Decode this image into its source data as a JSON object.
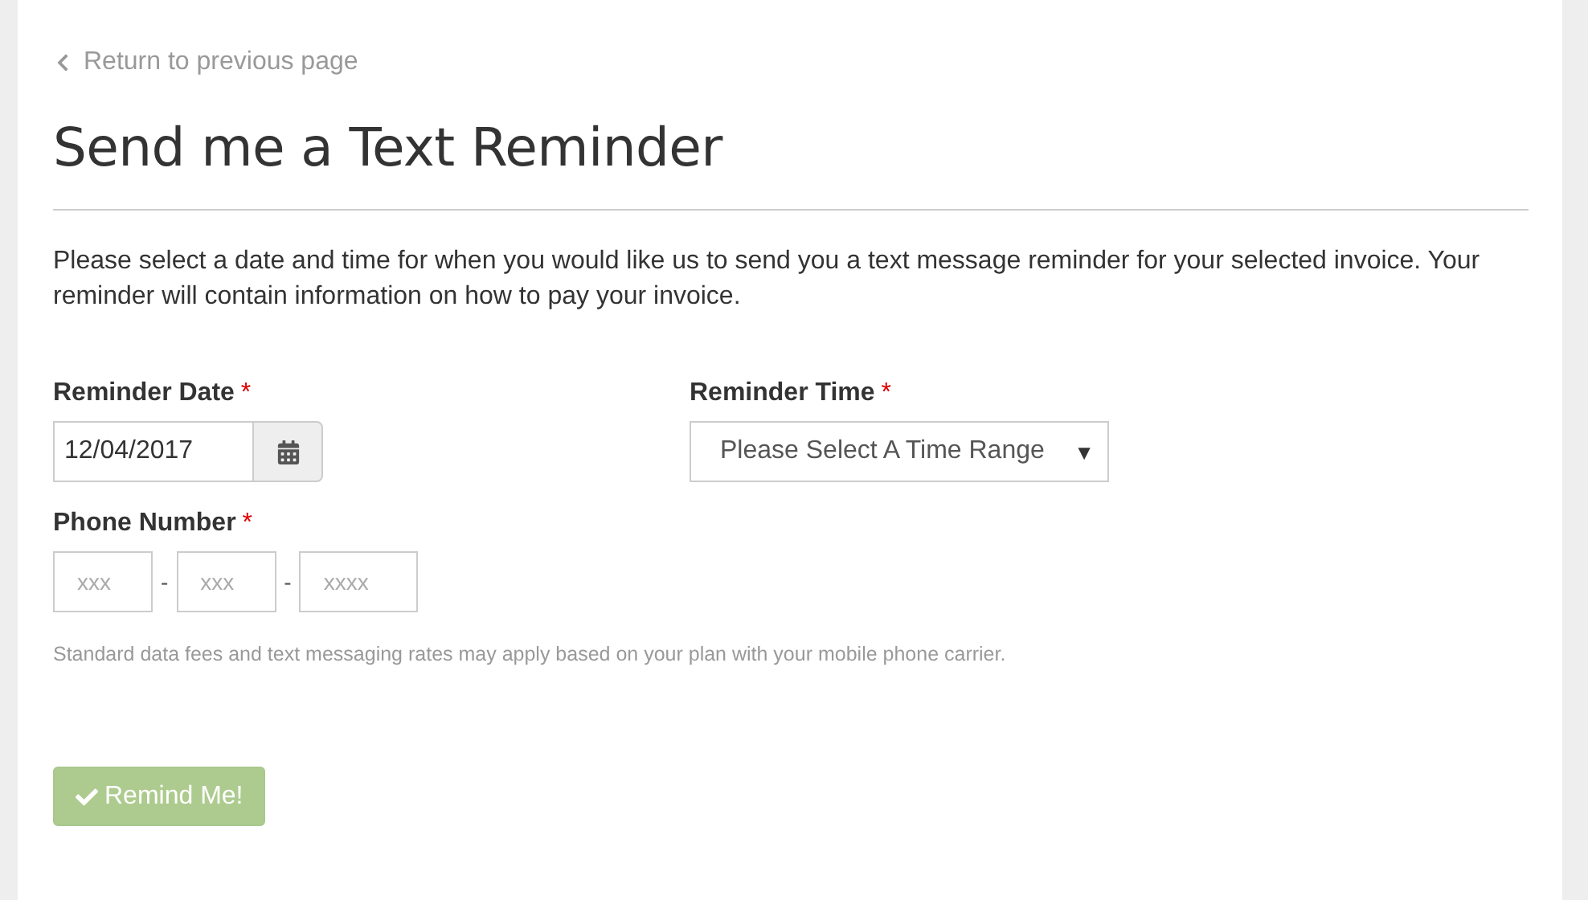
{
  "back_link": {
    "label": "Return to previous page"
  },
  "title": "Send me a Text Reminder",
  "intro": "Please select a date and time for when you would like us to send you a text message reminder for your selected invoice. Your reminder will contain information on how to pay your invoice.",
  "reminder_date": {
    "label": "Reminder Date",
    "required_mark": "*",
    "value": "12/04/2017"
  },
  "reminder_time": {
    "label": "Reminder Time",
    "required_mark": "*",
    "value": "Please Select A Time Range",
    "caret": "▼"
  },
  "phone_number": {
    "label": "Phone Number",
    "required_mark": "*",
    "parts": [
      {
        "placeholder": "xxx"
      },
      {
        "placeholder": "xxx"
      },
      {
        "placeholder": "xxxx"
      }
    ],
    "separator": "-"
  },
  "disclaimer": "Standard data fees and text messaging rates may apply based on your plan with your mobile phone carrier.",
  "submit": {
    "label": "Remind Me!",
    "disabled": true
  }
}
